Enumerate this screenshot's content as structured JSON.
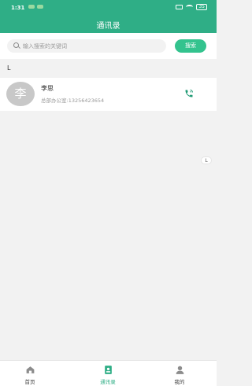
{
  "status_bar": {
    "time": "1:31",
    "battery": "35"
  },
  "header": {
    "title": "通讯录"
  },
  "search": {
    "placeholder": "输入搜索的关键词",
    "button_label": "搜索"
  },
  "section": {
    "letter": "L"
  },
  "contacts": [
    {
      "avatar_char": "李",
      "name": "李思",
      "subtitle": "总部办公室:13256423654",
      "action_icon": "phone-icon"
    }
  ],
  "index_badge": "L",
  "tabs": [
    {
      "label": "首页",
      "icon": "home-icon",
      "active": false
    },
    {
      "label": "通讯录",
      "icon": "contacts-icon",
      "active": true
    },
    {
      "label": "我的",
      "icon": "profile-icon",
      "active": false
    }
  ],
  "colors": {
    "primary": "#2fae86",
    "button": "#33c38e",
    "avatar": "#c8c8c8"
  }
}
